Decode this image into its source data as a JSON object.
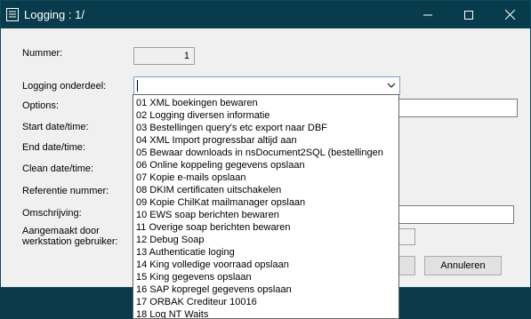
{
  "window": {
    "title": "Logging : 1/"
  },
  "labels": {
    "nummer": "Nummer:",
    "logging_onderdeel": "Logging onderdeel:",
    "options": "Options:",
    "start": "Start date/time:",
    "end": "End date/time:",
    "clean": "Clean date/time:",
    "referentie": "Referentie nummer:",
    "omschrijving": "Omschrijving:",
    "aangemaakt_line1": "Aangemaakt door",
    "aangemaakt_line2": "werkstation gebruiker:"
  },
  "fields": {
    "nummer_value": "1",
    "logging_onderdeel_value": ""
  },
  "dropdown": {
    "items": [
      "01 XML boekingen bewaren",
      "02 Logging diversen informatie",
      "03 Bestellingen query's etc export naar DBF",
      "04 XML Import progressbar altijd aan",
      "05 Bewaar downloads in nsDocument2SQL (bestellingen",
      "06 Online koppeling gegevens opslaan",
      "07 Kopie e-mails opslaan",
      "08 DKIM certificaten uitschakelen",
      "09 Kopie ChilKat mailmanager opslaan",
      "10 EWS soap berichten bewaren",
      "11 Overige soap berichten bewaren",
      "12 Debug Soap",
      "13 Authenticatie loging",
      "14 King volledige voorraad opslaan",
      "15 King gegevens opslaan",
      "16 SAP kopregel gegevens opslaan",
      "17 ORBAK Crediteur 10016",
      "18 Log NT Waits"
    ]
  },
  "buttons": {
    "annuleren": "Annuleren"
  }
}
